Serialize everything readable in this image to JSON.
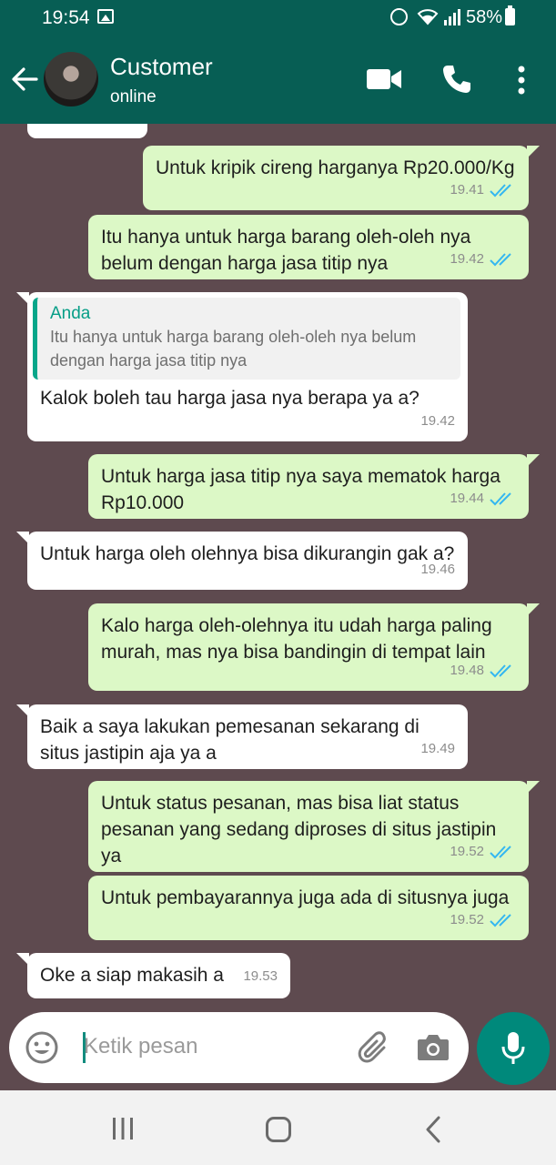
{
  "status_bar": {
    "time": "19:54",
    "battery": "58%"
  },
  "header": {
    "contact_name": "Customer",
    "contact_status": "online"
  },
  "messages": [
    {
      "dir": "out",
      "text": "Untuk kripik cireng harganya Rp20.000/Kg",
      "time": "19.41"
    },
    {
      "dir": "out",
      "text": "Itu hanya untuk harga barang oleh-oleh nya belum dengan harga jasa titip nya",
      "time": "19.42"
    },
    {
      "dir": "in",
      "quote_name": "Anda",
      "quote_text": "Itu hanya untuk harga barang oleh-oleh nya belum dengan harga jasa titip nya",
      "text": "Kalok boleh tau harga jasa nya berapa ya a?",
      "time": "19.42"
    },
    {
      "dir": "out",
      "text": "Untuk harga jasa titip nya saya mematok harga Rp10.000",
      "time": "19.44"
    },
    {
      "dir": "in",
      "text": "Untuk harga oleh olehnya bisa dikurangin gak a?",
      "time": "19.46"
    },
    {
      "dir": "out",
      "text": "Kalo harga oleh-olehnya itu udah harga paling murah, mas nya bisa bandingin di tempat lain",
      "time": "19.48"
    },
    {
      "dir": "in",
      "text": "Baik a saya lakukan pemesanan sekarang di situs jastipin aja ya a",
      "time": "19.49"
    },
    {
      "dir": "out",
      "text": "Untuk status pesanan, mas bisa liat status pesanan yang sedang diproses di situs jastipin ya",
      "time": "19.52"
    },
    {
      "dir": "out",
      "text": "Untuk pembayarannya juga ada di situsnya juga",
      "time": "19.52"
    },
    {
      "dir": "in",
      "text": "Oke a siap makasih a",
      "time": "19.53"
    }
  ],
  "composer": {
    "placeholder": "Ketik pesan"
  },
  "colors": {
    "header": "#075e54",
    "outgoing": "#dcf8c6",
    "incoming": "#ffffff",
    "wallpaper": "#5e4a4f",
    "read_ticks": "#34b7f1",
    "mic_button": "#00897b"
  }
}
